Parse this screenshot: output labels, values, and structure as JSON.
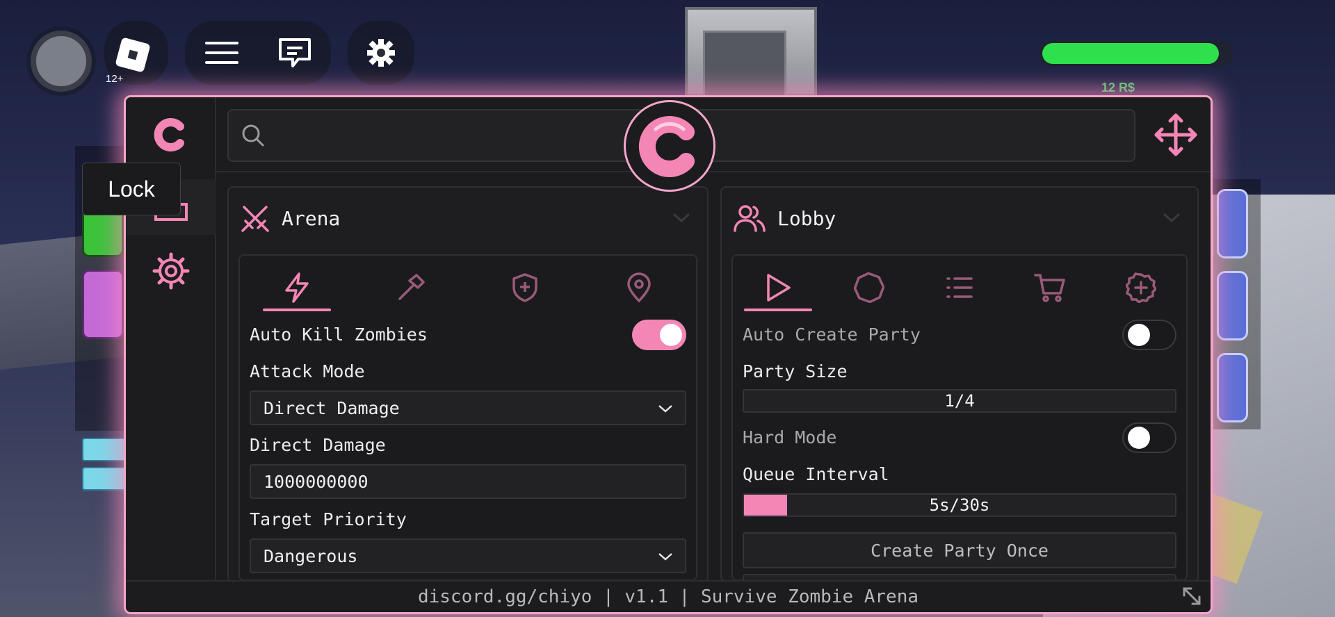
{
  "colors": {
    "accent": "#f486b6",
    "accent_glow": "#f3a6c8",
    "panel_bg": "#1e1e21",
    "health": "#2ee04c"
  },
  "game": {
    "age_rating": "12+",
    "robux": "12 R$",
    "health_fraction": 0.94,
    "tooltip": "Lock"
  },
  "search": {
    "placeholder": "",
    "value": ""
  },
  "sidebar": {
    "items": [
      {
        "icon": "home-icon"
      },
      {
        "icon": "gear-icon"
      }
    ]
  },
  "arena": {
    "title": "Arena",
    "tabs": [
      {
        "icon": "lightning-icon",
        "active": true
      },
      {
        "icon": "hammer-icon",
        "active": false
      },
      {
        "icon": "shield-plus-icon",
        "active": false
      },
      {
        "icon": "map-pin-icon",
        "active": false
      }
    ],
    "auto_kill_label": "Auto Kill Zombies",
    "auto_kill_on": true,
    "attack_mode_label": "Attack Mode",
    "attack_mode_value": "Direct Damage",
    "direct_damage_label": "Direct Damage",
    "direct_damage_value": "1000000000",
    "target_priority_label": "Target Priority",
    "target_priority_value": "Dangerous"
  },
  "lobby": {
    "title": "Lobby",
    "tabs": [
      {
        "icon": "play-icon",
        "active": true
      },
      {
        "icon": "octagon-icon",
        "active": false
      },
      {
        "icon": "list-icon",
        "active": false
      },
      {
        "icon": "cart-icon",
        "active": false
      },
      {
        "icon": "plus-circle-icon",
        "active": false
      }
    ],
    "auto_create_label": "Auto Create Party",
    "auto_create_on": false,
    "party_size_label": "Party Size",
    "party_size_value": "1/4",
    "party_size_fraction": 0.0,
    "hard_mode_label": "Hard Mode",
    "hard_mode_on": false,
    "queue_interval_label": "Queue Interval",
    "queue_interval_value": "5s/30s",
    "queue_interval_fraction": 0.1,
    "create_party_button": "Create Party Once"
  },
  "footer": {
    "text": "discord.gg/chiyo | v1.1 | Survive Zombie Arena"
  }
}
